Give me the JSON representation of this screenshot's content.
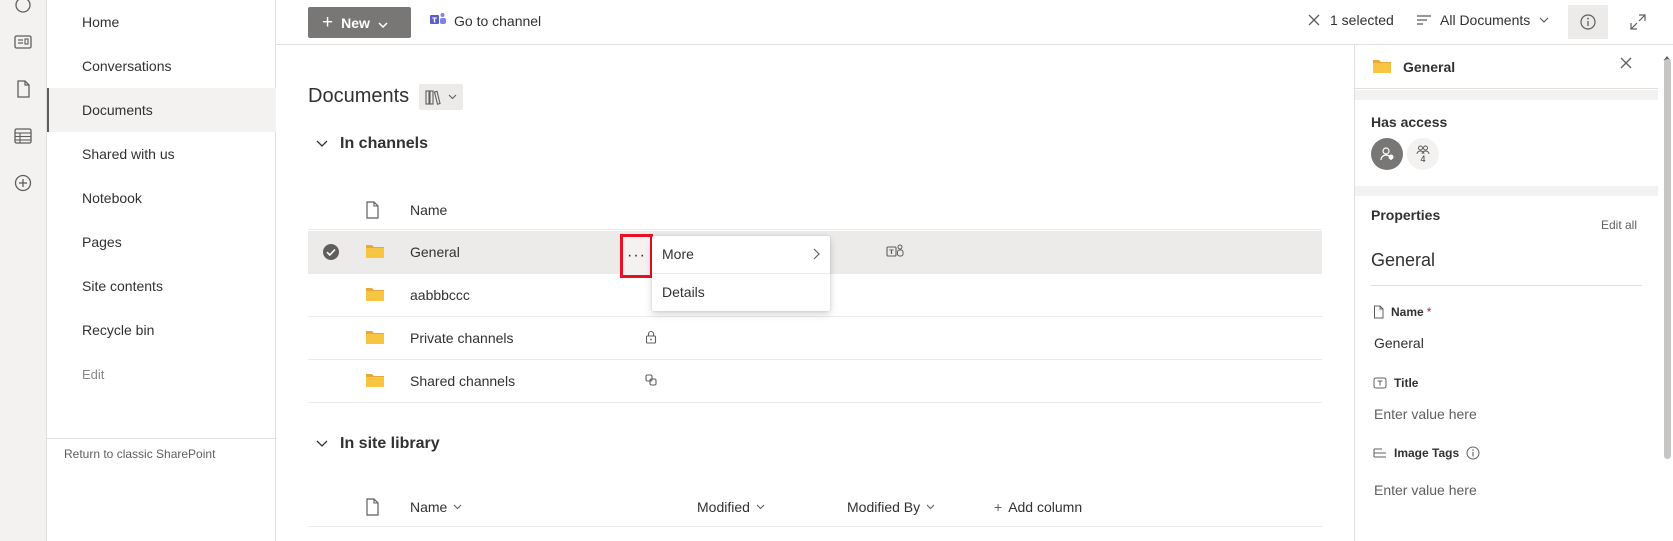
{
  "nav": {
    "items": [
      {
        "label": "Home"
      },
      {
        "label": "Conversations"
      },
      {
        "label": "Documents"
      },
      {
        "label": "Shared with us"
      },
      {
        "label": "Notebook"
      },
      {
        "label": "Pages"
      },
      {
        "label": "Site contents"
      },
      {
        "label": "Recycle bin"
      }
    ],
    "edit_label": "Edit",
    "classic_link": "Return to classic SharePoint"
  },
  "commandbar": {
    "new_label": "New",
    "goto_channel": "Go to channel",
    "selected_count": "1 selected",
    "view_name": "All Documents"
  },
  "library": {
    "title": "Documents",
    "channels_group": "In channels",
    "site_group": "In site library",
    "name_header": "Name",
    "rows": [
      {
        "name": "General"
      },
      {
        "name": "aabbbccc"
      },
      {
        "name": "Private channels"
      },
      {
        "name": "Shared channels"
      }
    ],
    "site_headers": {
      "name": "Name",
      "modified": "Modified",
      "modified_by": "Modified By",
      "add_column": "Add column"
    }
  },
  "more_button": "···",
  "context_menu": {
    "more": "More",
    "details": "Details"
  },
  "details_pane": {
    "title": "General",
    "has_access": "Has access",
    "group_count": "4",
    "properties": "Properties",
    "edit_all": "Edit all",
    "item_title": "General",
    "fields": {
      "name_label": "Name",
      "required_mark": "*",
      "name_value": "General",
      "title_label": "Title",
      "title_placeholder": "Enter value here",
      "tags_label": "Image Tags",
      "tags_placeholder": "Enter value here"
    }
  },
  "colors": {
    "accent_button": "#797775",
    "selection_highlight": "#e81123",
    "folder": "#f8c543",
    "teams": "#5b5fc7"
  }
}
